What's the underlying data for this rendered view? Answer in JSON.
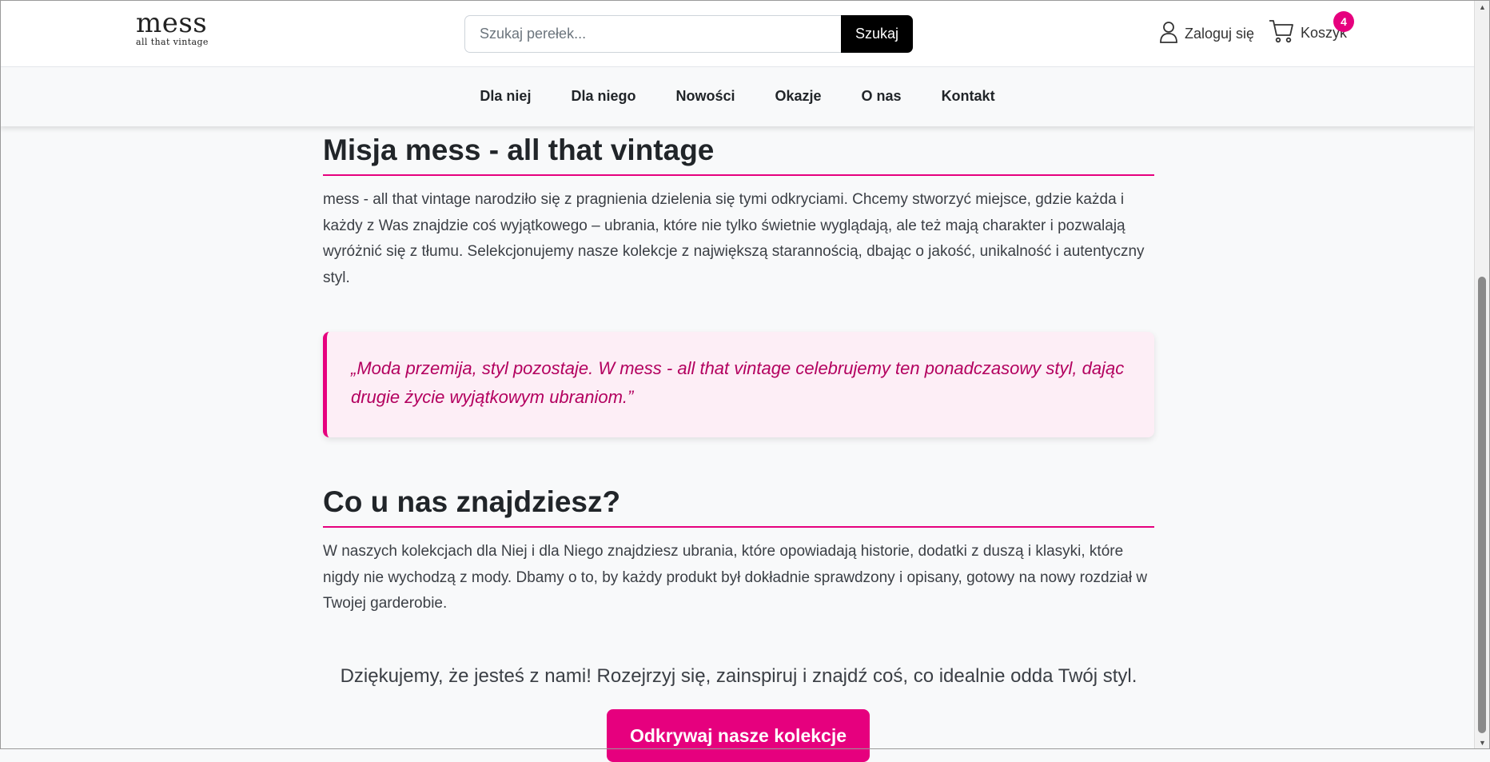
{
  "header": {
    "logo_main": "mess",
    "logo_sub": "all that vintage",
    "search_placeholder": "Szukaj perełek...",
    "search_button": "Szukaj",
    "login_label": "Zaloguj się",
    "cart_label": "Koszyk",
    "cart_count": "4",
    "user_icon": "user-icon",
    "cart_icon": "cart-icon"
  },
  "nav": {
    "items": [
      {
        "label": "Dla niej"
      },
      {
        "label": "Dla niego"
      },
      {
        "label": "Nowości"
      },
      {
        "label": "Okazje"
      },
      {
        "label": "O nas"
      },
      {
        "label": "Kontakt"
      }
    ]
  },
  "content": {
    "mission_heading": "Misja mess - all that vintage",
    "mission_text": "mess - all that vintage narodziło się z pragnienia dzielenia się tymi odkryciami. Chcemy stworzyć miejsce, gdzie każda i każdy z Was znajdzie coś wyjątkowego – ubrania, które nie tylko świetnie wyglądają, ale też mają charakter i pozwalają wyróżnić się z tłumu. Selekcjonujemy nasze kolekcje z największą starannością, dbając o jakość, unikalność i autentyczny styl.",
    "quote": "„Moda przemija, styl pozostaje. W mess - all that vintage celebrujemy ten ponadczasowy styl, dając drugie życie wyjątkowym ubraniom.”",
    "offer_heading": "Co u nas znajdziesz?",
    "offer_text": "W naszych kolekcjach dla Niej i dla Niego znajdziesz ubrania, które opowiadają historie, dodatki z duszą i klasyki, które nigdy nie wychodzą z mody. Dbamy o to, by każdy produkt był dokładnie sprawdzony i opisany, gotowy na nowy rozdział w Twojej garderobie.",
    "thanks": "Dziękujemy, że jesteś z nami! Rozejrzyj się, zainspiruj i znajdź coś, co idealnie odda Twój styl.",
    "cta": "Odkrywaj nasze kolekcje"
  },
  "colors": {
    "accent": "#e6007e",
    "quote_bg": "#fdeef6",
    "quote_text": "#b3005f"
  }
}
